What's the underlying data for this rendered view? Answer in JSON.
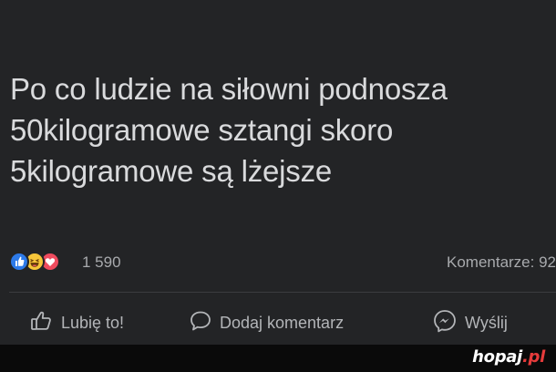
{
  "post": {
    "text_lines": [
      "Po co ludzie na siłowni podnosza",
      "50kilogramowe sztangi skoro",
      "5kilogramowe są lżejsze"
    ]
  },
  "stats": {
    "reaction_icons": [
      "like-icon",
      "haha-icon",
      "love-icon"
    ],
    "reaction_count": "1 590",
    "comment_count": "Komentarze: 92"
  },
  "actions": {
    "like_label": "Lubię to!",
    "comment_label": "Dodaj komentarz",
    "send_label": "Wyślij"
  },
  "watermark": {
    "name": "hopaj",
    "tld": ".pl"
  },
  "colors": {
    "background": "#232426",
    "like_blue": "#2d7ae8",
    "haha_yellow": "#f7c63a",
    "love_red": "#ef4b5e",
    "watermark_red": "#e53b3b"
  }
}
